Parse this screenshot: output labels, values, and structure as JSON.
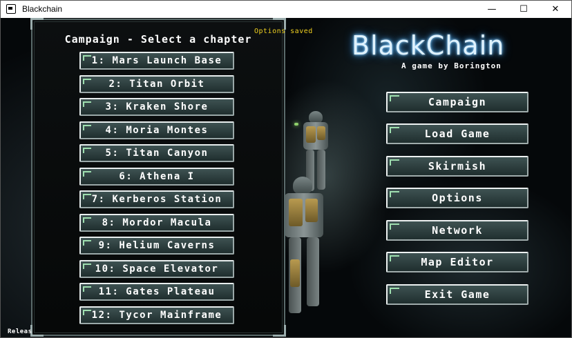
{
  "window": {
    "title": "Blackchain",
    "controls": {
      "minimize": "—",
      "maximize": "☐",
      "close": "✕"
    }
  },
  "game": {
    "logo": "BlackChain",
    "subtitle": "A game by Borington",
    "status": "Options saved",
    "release": "Releas"
  },
  "campaign_panel": {
    "title": "Campaign - Select a chapter",
    "chapters": [
      "1: Mars Launch Base",
      "2: Titan Orbit",
      "3: Kraken Shore",
      "4: Moria Montes",
      "5: Titan Canyon",
      "6: Athena I",
      "7: Kerberos Station",
      "8: Mordor Macula",
      "9: Helium Caverns",
      "10: Space Elevator",
      "11: Gates Plateau",
      "12: Tycor Mainframe"
    ]
  },
  "main_menu": {
    "items": [
      "Campaign",
      "Load Game",
      "Skirmish",
      "Options",
      "Network",
      "Map Editor",
      "Exit Game"
    ]
  },
  "colors": {
    "button_fill": "#2c3e3e",
    "button_border": "#e8eeee",
    "status_text": "#f0d020",
    "logo_glow": "#4aa8e8"
  }
}
